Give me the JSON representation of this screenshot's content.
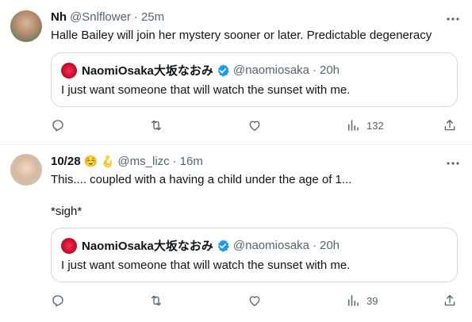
{
  "tweets": [
    {
      "name": "Nh",
      "handle": "@Snlflower",
      "separator": "·",
      "time": "25m",
      "text_lines": [
        "Halle Bailey will join her mystery sooner or later. Predictable degeneracy"
      ],
      "emojis": [],
      "quote": {
        "name": "NaomiOsaka大坂なおみ",
        "handle": "@naomiosaka",
        "separator": "·",
        "time": "20h",
        "text": "I just want someone that will watch the sunset with me."
      },
      "actions": {
        "views_count": "132"
      }
    },
    {
      "name": "10/28",
      "handle": "@ms_lizc",
      "separator": "·",
      "time": "16m",
      "text_lines": [
        "This.... coupled with a having a child under the age of 1...",
        "*sigh*"
      ],
      "emojis": [
        "☺️",
        "🪝"
      ],
      "quote": {
        "name": "NaomiOsaka大坂なおみ",
        "handle": "@naomiosaka",
        "separator": "·",
        "time": "20h",
        "text": "I just want someone that will watch the sunset with me."
      },
      "actions": {
        "views_count": "39"
      }
    }
  ],
  "icons": {
    "more": "more-horizontal-icon",
    "reply": "reply-icon",
    "retweet": "retweet-icon",
    "like": "heart-icon",
    "views": "views-chart-icon",
    "share": "share-icon",
    "verified": "verified-badge-icon"
  },
  "colors": {
    "text_primary": "#0f1419",
    "text_secondary": "#536471",
    "border": "#cfd9de",
    "verified_blue": "#1d9bf0"
  }
}
